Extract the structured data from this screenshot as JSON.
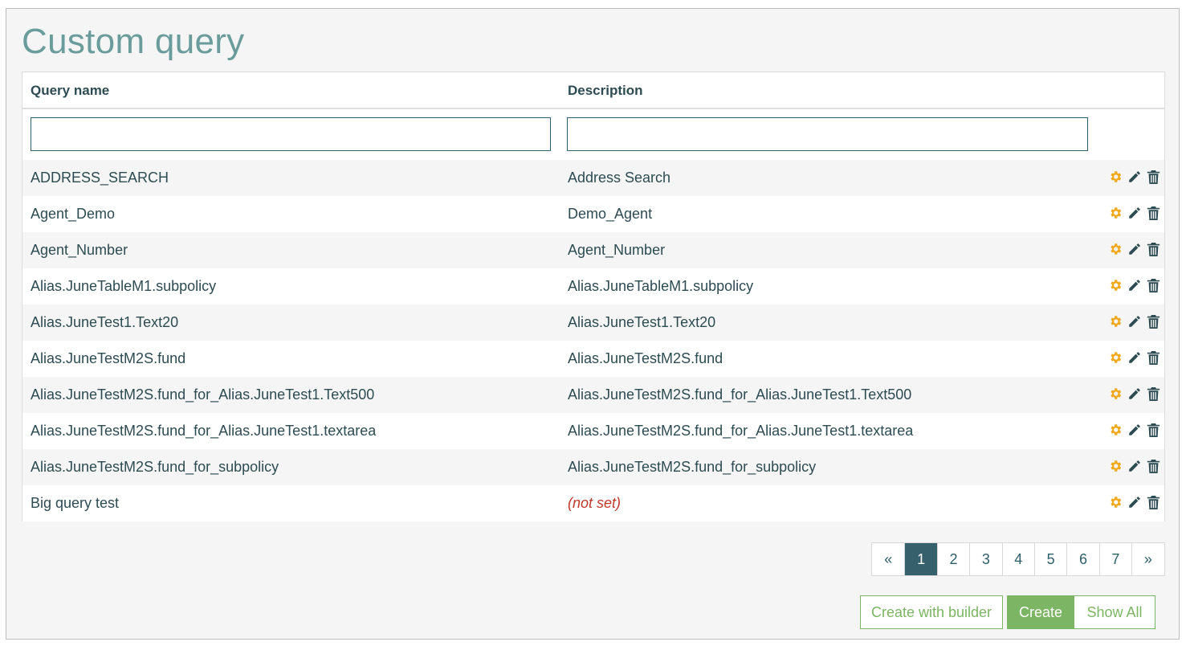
{
  "page": {
    "title": "Custom query"
  },
  "table": {
    "headers": {
      "name": "Query name",
      "description": "Description"
    },
    "rows": [
      {
        "name": "ADDRESS_SEARCH",
        "description": "Address Search",
        "not_set": false
      },
      {
        "name": "Agent_Demo",
        "description": "Demo_Agent",
        "not_set": false
      },
      {
        "name": "Agent_Number",
        "description": "Agent_Number",
        "not_set": false
      },
      {
        "name": "Alias.JuneTableM1.subpolicy",
        "description": "Alias.JuneTableM1.subpolicy",
        "not_set": false
      },
      {
        "name": "Alias.JuneTest1.Text20",
        "description": "Alias.JuneTest1.Text20",
        "not_set": false
      },
      {
        "name": "Alias.JuneTestM2S.fund",
        "description": "Alias.JuneTestM2S.fund",
        "not_set": false
      },
      {
        "name": "Alias.JuneTestM2S.fund_for_Alias.JuneTest1.Text500",
        "description": "Alias.JuneTestM2S.fund_for_Alias.JuneTest1.Text500",
        "not_set": false
      },
      {
        "name": "Alias.JuneTestM2S.fund_for_Alias.JuneTest1.textarea",
        "description": "Alias.JuneTestM2S.fund_for_Alias.JuneTest1.textarea",
        "not_set": false
      },
      {
        "name": "Alias.JuneTestM2S.fund_for_subpolicy",
        "description": "Alias.JuneTestM2S.fund_for_subpolicy",
        "not_set": false
      },
      {
        "name": "Big query test",
        "description": "(not set)",
        "not_set": true
      }
    ],
    "row_actions": [
      "gear-icon",
      "pencil-icon",
      "trash-icon"
    ]
  },
  "pagination": {
    "prev": "«",
    "pages": [
      "1",
      "2",
      "3",
      "4",
      "5",
      "6",
      "7"
    ],
    "active": "1",
    "next": "»"
  },
  "buttons": {
    "create_with_builder": "Create with builder",
    "create": "Create",
    "show_all": "Show All"
  },
  "colors": {
    "title": "#6b9c9c",
    "text": "#2d4b52",
    "accent_green": "#7cb563",
    "pager_active": "#35606c",
    "gear": "#f0a81c",
    "not_set": "#c0392b"
  }
}
